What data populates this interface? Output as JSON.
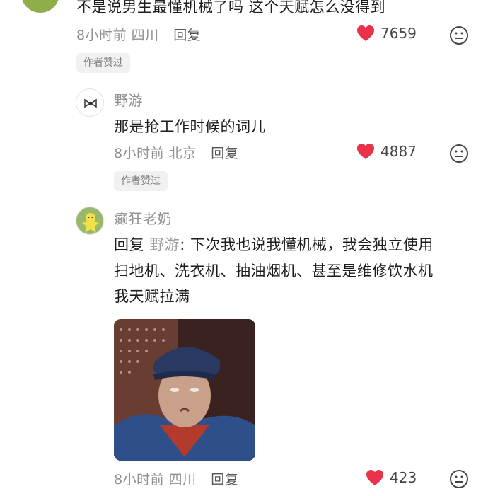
{
  "comments": [
    {
      "text": "不是说男生最懂机械了吗 这个天赋怎么没得到",
      "time": "8小时前",
      "location": "四川",
      "reply_label": "回复",
      "likes": "7659",
      "badge": "作者赞过"
    },
    {
      "username": "野游",
      "text": "那是抢工作时候的词儿",
      "time": "8小时前",
      "location": "北京",
      "reply_label": "回复",
      "likes": "4887",
      "badge": "作者赞过"
    },
    {
      "username": "癫狂老奶",
      "reply_prefix": "回复",
      "reply_to": "野游",
      "line1": ": 下次我也说我懂机械，我会独立使用",
      "line2": "扫地机、洗衣机、抽油烟机、甚至是维修饮水机",
      "line3": "我天赋拉满",
      "time": "8小时前",
      "location": "四川",
      "reply_label": "回复",
      "likes": "423"
    }
  ],
  "colors": {
    "heart": "#e8334a",
    "muted": "#8f8f8f",
    "text": "#1d1d1d",
    "badge_bg": "#f1f1f1"
  },
  "icons": [
    "heart-icon",
    "dislike-face-icon",
    "bow-avatar-icon"
  ]
}
